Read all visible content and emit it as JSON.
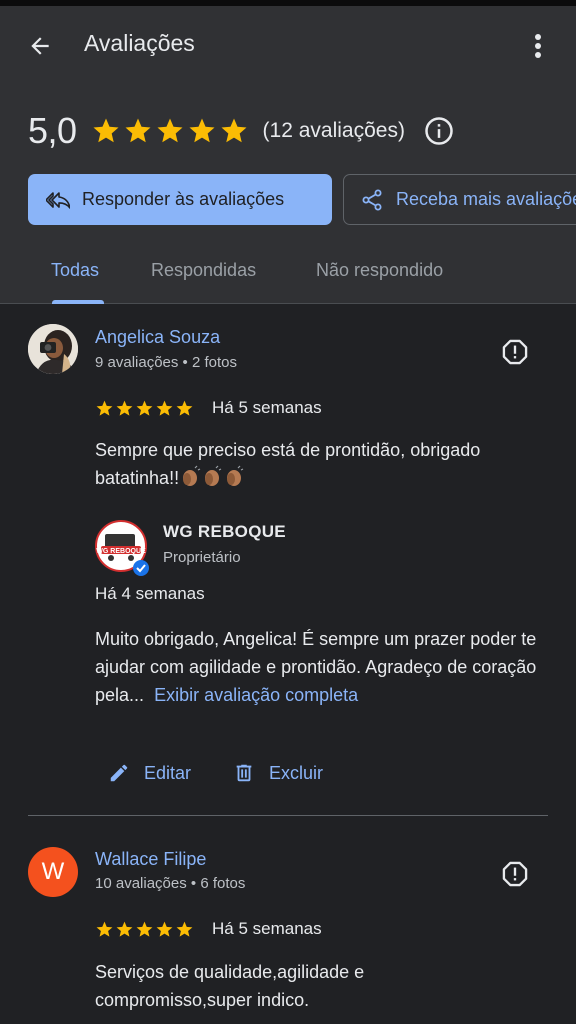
{
  "header": {
    "title": "Avaliações",
    "rating_value": "5,0",
    "rating_count": "(12 avaliações)",
    "primary_button": "Responder às avaliações",
    "secondary_button": "Receba mais avaliações"
  },
  "tabs": [
    {
      "label": "Todas",
      "active": true
    },
    {
      "label": "Respondidas",
      "active": false
    },
    {
      "label": "Não respondido",
      "active": false
    }
  ],
  "reviews": [
    {
      "name": "Angelica Souza",
      "meta": "9 avaliações • 2 fotos",
      "stars": 5,
      "time": "Há 5 semanas",
      "text": "Sempre que preciso está de prontidão, obrigado batatinha!!",
      "owner_reply": {
        "name": "WG REBOQUE",
        "role": "Proprietário",
        "time": "Há 4 semanas",
        "text": "Muito obrigado, Angelica! É sempre um prazer poder te ajudar com agilidade e prontidão. Agradeço de coração pela...",
        "expand_link": "Exibir avaliação completa",
        "logo_text": "WG REBOQUE"
      },
      "edit_label": "Editar",
      "delete_label": "Excluir"
    },
    {
      "name": "Wallace Filipe",
      "initial": "W",
      "meta": "10 avaliações • 6 fotos",
      "stars": 5,
      "time": "Há 5 semanas",
      "text": "Serviços de qualidade,agilidade e compromisso,super indico."
    }
  ],
  "colors": {
    "accent": "#8ab4f8",
    "star": "#fbbc04",
    "header_bg": "#303134",
    "page_bg": "#202124",
    "avatar_w": "#f4511e"
  },
  "icons": [
    "back-arrow-icon",
    "more-vert-icon",
    "star-icon",
    "info-icon",
    "reply-all-icon",
    "share-icon",
    "flag-icon",
    "verified-icon",
    "pencil-icon",
    "trash-icon",
    "clap-emoji"
  ]
}
